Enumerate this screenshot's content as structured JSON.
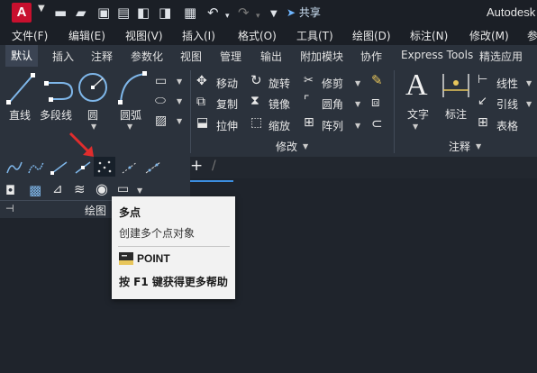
{
  "app": {
    "logo_letter": "A",
    "title": "Autodesk",
    "share_label": "共享"
  },
  "menu": [
    "文件(F)",
    "编辑(E)",
    "视图(V)",
    "插入(I)",
    "格式(O)",
    "工具(T)",
    "绘图(D)",
    "标注(N)",
    "修改(M)",
    "参"
  ],
  "tabs": [
    "默认",
    "插入",
    "注释",
    "参数化",
    "视图",
    "管理",
    "输出",
    "附加模块",
    "协作",
    "Express Tools",
    "精选应用"
  ],
  "draw": {
    "line": "直线",
    "polyline": "多段线",
    "circle": "圆",
    "arc": "圆弧",
    "panel": "绘图"
  },
  "modify": {
    "move": "移动",
    "rotate": "旋转",
    "trim": "修剪",
    "copy": "复制",
    "mirror": "镜像",
    "fillet": "圆角",
    "stretch": "拉伸",
    "scale": "缩放",
    "array": "阵列",
    "panel": "修改"
  },
  "annotation": {
    "text": "文字",
    "dimension": "标注",
    "linear": "线性",
    "leader": "引线",
    "table": "表格",
    "panel": "注释"
  },
  "tooltip": {
    "title": "多点",
    "desc": "创建多个点对象",
    "command": "POINT",
    "help": "按 F1 键获得更多帮助"
  },
  "doc_tab_add": "+",
  "colors": {
    "accent_red": "#e02d2d",
    "logo_red": "#c8102e"
  }
}
